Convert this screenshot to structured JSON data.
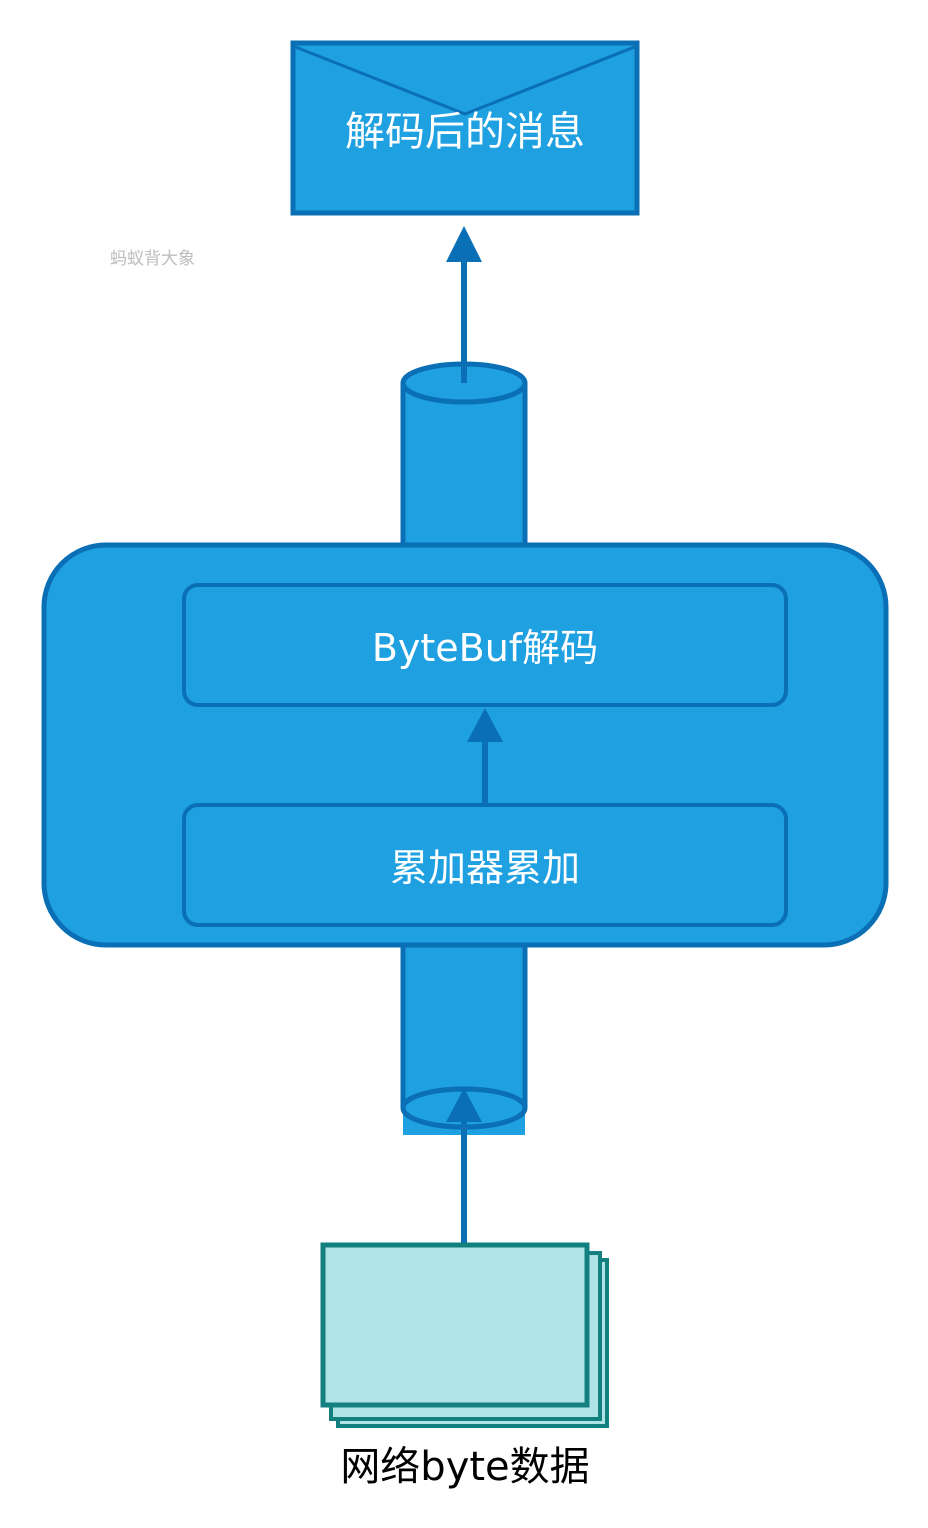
{
  "diagram": {
    "colors": {
      "fill_blue": "#1ea0e1",
      "stroke_blue": "#0a6fb4",
      "doc_fill": "#b0e3e6",
      "doc_stroke": "#12807f",
      "watermark": "#bdbdbd",
      "text_white": "#ffffff",
      "text_dark": "#000000"
    },
    "nodes": {
      "message": {
        "label": "解码后的消息",
        "icon": "envelope-icon"
      },
      "bytebuf_decode": {
        "label": "ByteBuf解码"
      },
      "accumulator": {
        "label": "累加器累加"
      },
      "network_data": {
        "label": "网络byte数据",
        "icon": "stacked-documents-icon"
      },
      "pipe": {
        "icon": "cylinder-icon"
      }
    },
    "watermark": "蚂蚁背大象"
  }
}
